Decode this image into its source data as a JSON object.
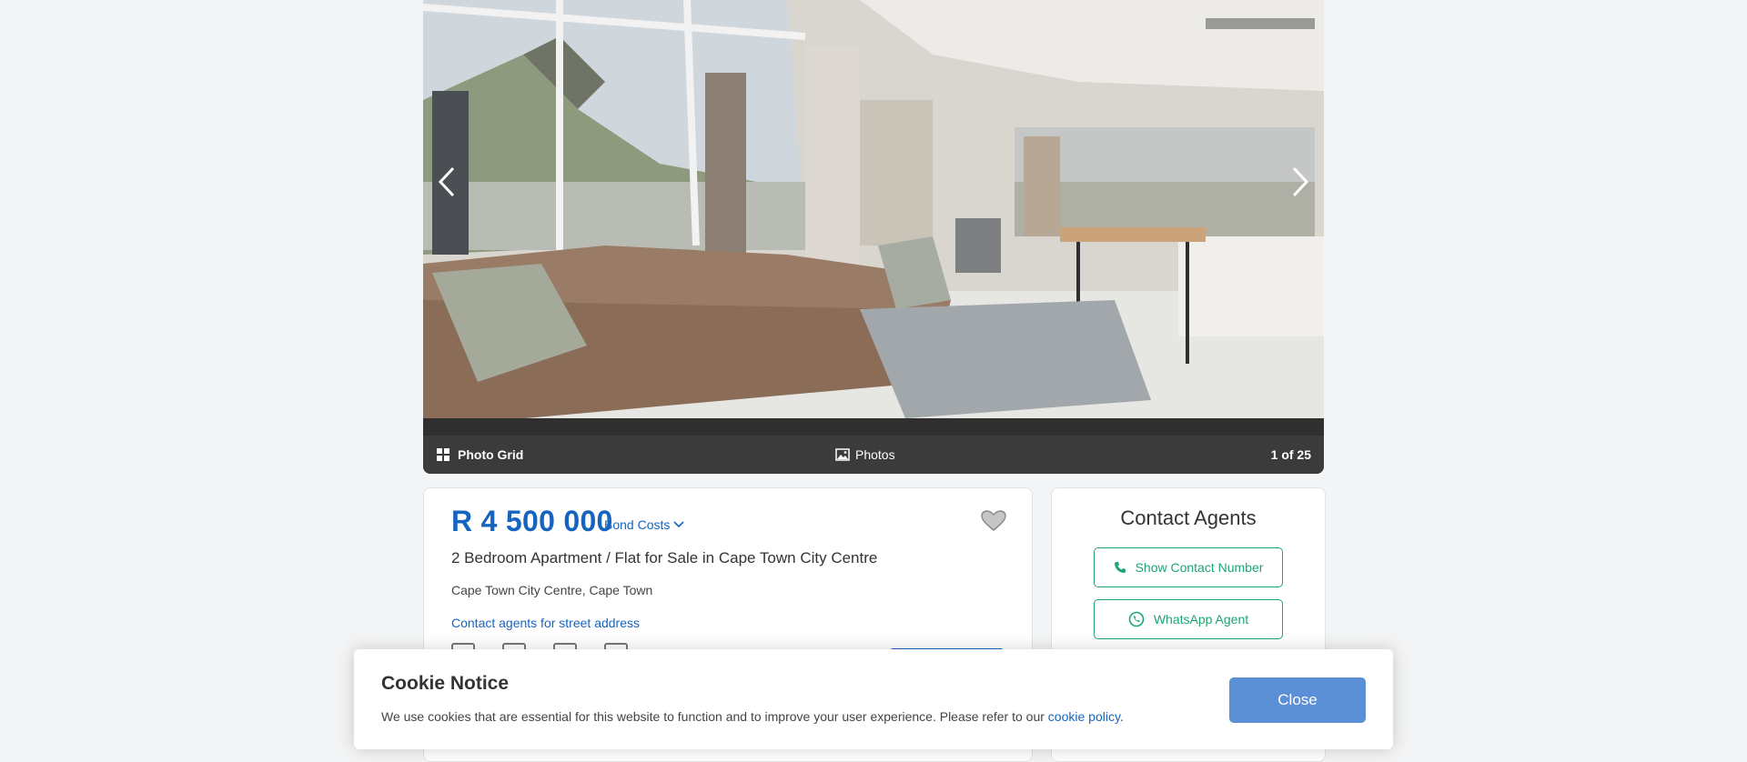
{
  "gallery": {
    "photo_grid_label": "Photo Grid",
    "photos_label": "Photos",
    "counter": "1 of 25"
  },
  "listing": {
    "price": "R 4 500 000",
    "bond_costs_label": "Bond Costs",
    "title": "2 Bedroom Apartment / Flat for Sale in Cape Town City Centre",
    "location": "Cape Town City Centre, Cape Town",
    "street_address_link": "Contact agents for street address"
  },
  "contact": {
    "heading": "Contact Agents",
    "show_number_label": "Show Contact Number",
    "whatsapp_label": "WhatsApp Agent"
  },
  "cookie": {
    "title": "Cookie Notice",
    "text": "We use cookies that are essential for this website to function and to improve your user experience. Please refer to our ",
    "link": "cookie policy",
    "suffix": ".",
    "close_label": "Close"
  },
  "colors": {
    "accent_blue": "#1565c0",
    "whatsapp_green": "#1da572",
    "close_button": "#5b8fd6"
  }
}
